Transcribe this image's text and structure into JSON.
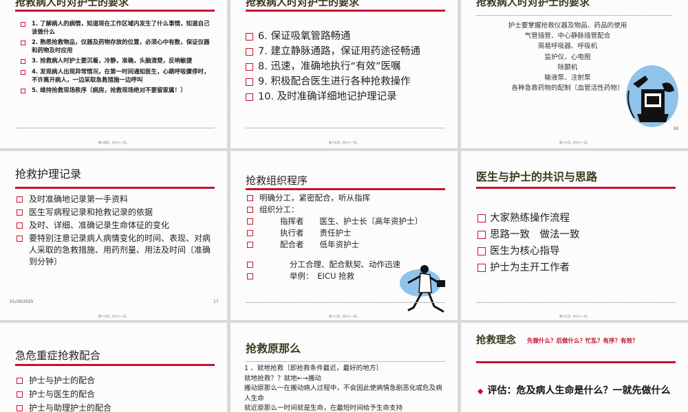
{
  "footer_text": "第十四页，共七十一页。",
  "slide1": {
    "title": "抢救病人时对护士的要求",
    "items": [
      "1. 了解病人的病情，知道现在工作区域内发生了什么事情，知道自己该做什么",
      "2. 熟悉抢救物品，仪器及药物存放的位置，必须心中有数，保证仪器和药物及时应用",
      "3. 抢救病人时护士要沉着，冷静，准确，头脑清楚，反响敏捷",
      "4. 发现病人出现异常情况，在第一时间通知医生，心跳呼吸骤停时，不许离开病人，一边采取急救措施一边呼叫",
      "5. 维持抢救现场秩序〔病房，抢救现场绝对不要留家属！〕"
    ],
    "footer": "第十四页，共七十一页。"
  },
  "slide2": {
    "title": "抢救病人时对护士的要求",
    "items": [
      "6. 保证吸氧管路畅通",
      "7. 建立静脉通路，保证用药途径畅通",
      "8. 迅速，准确地执行“有效”医嘱",
      "9. 积极配合医生进行各种抢救操作",
      "10. 及时准确详细地记护理记录"
    ],
    "footer": "第十五页，共七十一页。"
  },
  "slide3": {
    "title": "抢救病人时对护士的要求",
    "lines": [
      "护士要掌握抢救仪器及物品、药品的使用",
      "气管插管、中心静脉插管配合",
      "简易呼吸器、呼吸机",
      "监护仪、心电图",
      "除颤机",
      "输液泵、注射泵",
      "各种急救药物的配制〔血管活性药物〕"
    ],
    "page_number": "16",
    "footer": "第十六页，共七十一页。"
  },
  "slide4": {
    "title": "抢救护理记录",
    "items": [
      "及时准确地记录第一手资料",
      "医生写病程记录和抢救记录的依据",
      "及时、详细、准确记录生命体征的变化",
      "要特别注意记录病人病情变化的时间、表现、对病人采取的急救措施、用药剂量、用法及时间〔准确到分钟〕"
    ],
    "date": "01/26/2025",
    "page_number": "17",
    "footer": "第十七页，共七十一页。"
  },
  "slide5": {
    "title": "抢救组织程序",
    "item1": "明确分工，紧密配合，听从指挥",
    "item2": "组织分工：",
    "row1_role": "指挥者",
    "row1_people": "医生、护士长〔高年资护士〕",
    "row2_role": "执行者",
    "row2_people": "责任护士",
    "row3_role": "配合者",
    "row3_people": "低年资护士",
    "item6": "分工合理、配合默契、动作迅速",
    "item7_label": "举例：",
    "item7_value": "EICU 抢救",
    "footer": "第十八页，共七十一页。"
  },
  "slide6": {
    "title": "医生与护士的共识与思路",
    "items": [
      "大家熟练操作流程",
      "思路一致　做法一致",
      "医生为核心指导",
      "护士为主开工作者"
    ],
    "footer": "第十九页，共七十一页。"
  },
  "slide7": {
    "title": "急危重症抢救配合",
    "items": [
      "护士与护士的配合",
      "护士与医生的配合",
      "护士与助理护士的配合"
    ]
  },
  "slide8": {
    "title": "抢救原那么",
    "lines": [
      "1 、就地抢救〔即抢救条件最近，最好的地方〕",
      "就地抢救？？就地←→搬动",
      "搬动原那么一在搬动病人过程中，不会因此使病情急剧恶化或危及病人生命",
      "就近原那么一时间就是生命，在最短时间给予生命支持"
    ]
  },
  "slide9": {
    "title": "抢救理念",
    "subtitle": "先做什么？后做什么？忙乱？有序？有效？",
    "item": "评估：危及病人生命是什么？一就先做什么"
  }
}
